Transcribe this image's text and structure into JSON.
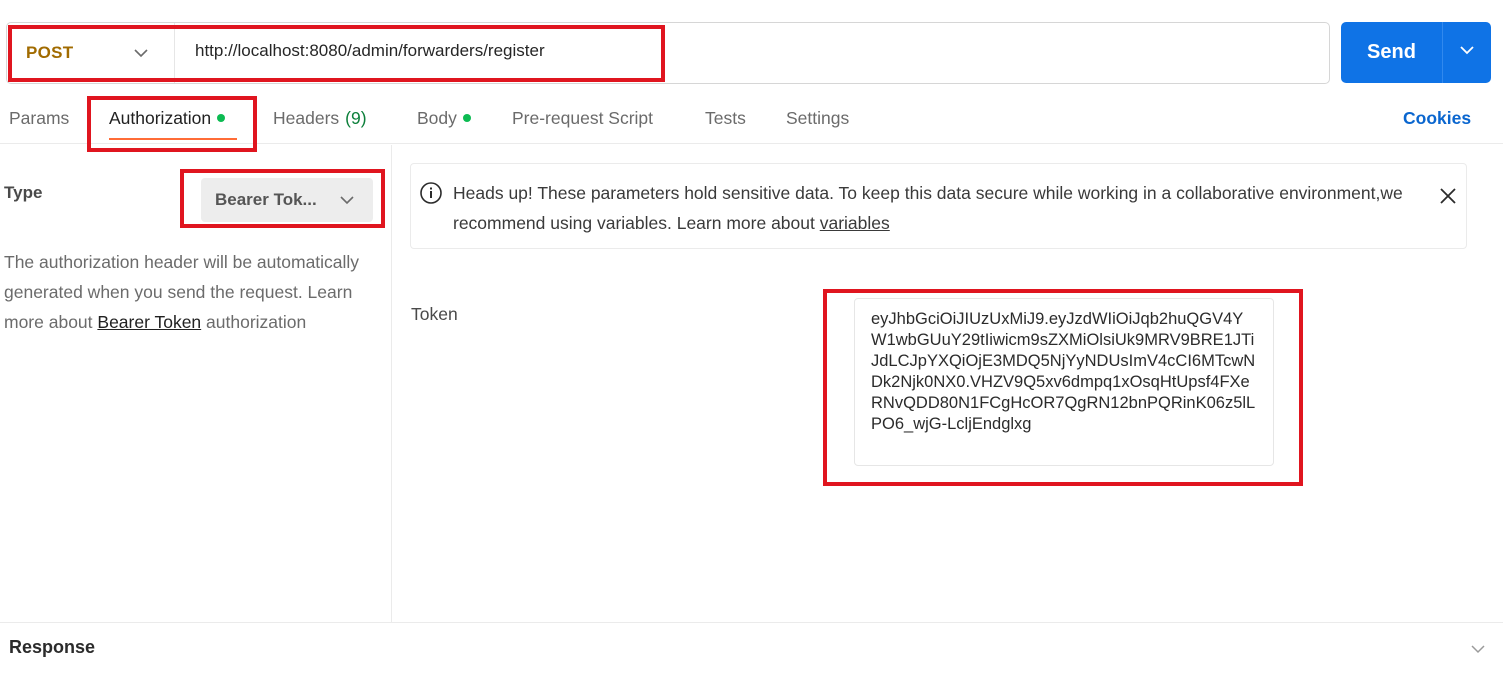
{
  "request": {
    "method": "POST",
    "url": "http://localhost:8080/admin/forwarders/register",
    "send_label": "Send"
  },
  "tabs": [
    {
      "label": "Params"
    },
    {
      "label": "Authorization",
      "dot": true,
      "active": true
    },
    {
      "label": "Headers",
      "count": "(9)"
    },
    {
      "label": "Body",
      "dot": true
    },
    {
      "label": "Pre-request Script"
    },
    {
      "label": "Tests"
    },
    {
      "label": "Settings"
    }
  ],
  "cookies_label": "Cookies",
  "auth": {
    "type_label": "Type",
    "type_value": "Bearer Tok...",
    "description": "The authorization header will be automatically generated when you send the request. Learn more about ",
    "description_link": "Bearer Token",
    "description_suffix": " authorization"
  },
  "notice": {
    "text": "Heads up! These parameters hold sensitive data. To keep this data secure while working in a collaborative environment,we recommend using variables. Learn more about ",
    "link": "variables"
  },
  "token": {
    "label": "Token",
    "value": "eyJhbGciOiJIUzUxMiJ9.eyJzdWIiOiJqb2huQGV4YW1wbGUuY29tIiwicm9sZXMiOlsiUk9MRV9BRE1JTiJdLCJpYXQiOjE3MDQ5NjYyNDUsImV4cCI6MTcwNDk2Njk0NX0.VHZV9Q5xv6dmpq1xOsqHtUpsf4FXeRNvQDD80N1FCgHcOR7QgRN12bnPQRinK06z5lLPO6_wjG-LcljEndglxg"
  },
  "response": {
    "label": "Response"
  },
  "colors": {
    "send_button": "#0f73e6",
    "method": "#a16b00",
    "highlight": "#e0151f",
    "active_tab_underline": "#ff6c37",
    "status_dot": "#0cbb52",
    "cookies": "#0a66cf"
  }
}
